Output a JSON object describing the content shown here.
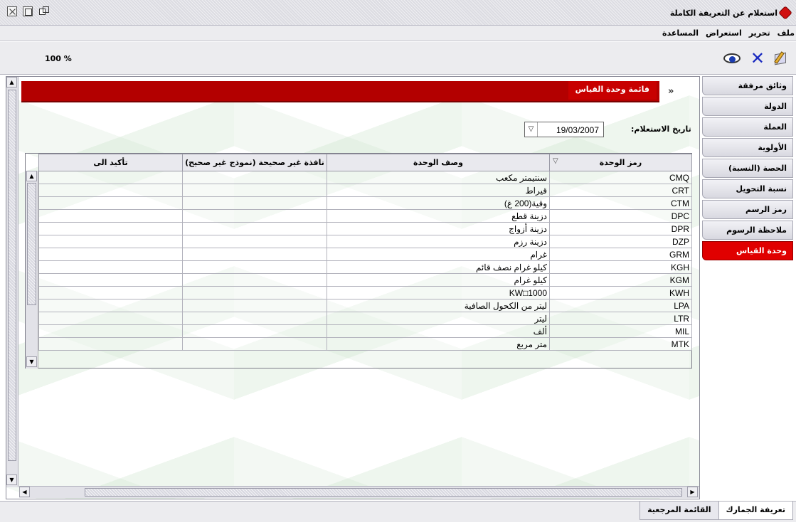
{
  "window": {
    "title": "استعلام عن التعريفة الكاملة"
  },
  "menu": [
    "ملف",
    "تحرير",
    "استعراض",
    "المساعدة"
  ],
  "toolbar": {
    "zoom": "100 %"
  },
  "panel": {
    "title": "قائمة وحدة القياس",
    "date_label": "تاريخ الاستعلام:",
    "date_value": "19/03/2007"
  },
  "table": {
    "columns": [
      "رمز الوحدة",
      "وصف الوحدة",
      "نافذة غير صحيحة (نموذج غير صحيح)",
      "تأكيد الى"
    ],
    "rows": [
      [
        "CMQ",
        "سنتيمتر مكعب"
      ],
      [
        "CRT",
        "قيراط"
      ],
      [
        "CTM",
        "وقية(200 غ)"
      ],
      [
        "DPC",
        "دزينة قطع"
      ],
      [
        "DPR",
        "دزينة أزواج"
      ],
      [
        "DZP",
        "دزينة رزم"
      ],
      [
        "GRM",
        "غرام"
      ],
      [
        "KGH",
        "كيلو غرام نصف قائم"
      ],
      [
        "KGM",
        "كيلو غرام"
      ],
      [
        "KWH",
        "1000□KW"
      ],
      [
        "LPA",
        "ليتر من الكحول الصافية"
      ],
      [
        "LTR",
        "ليتر"
      ],
      [
        "MIL",
        "ألف"
      ],
      [
        "MTK",
        "متر مربع"
      ]
    ]
  },
  "side_tabs": [
    "وثائق مرفقة",
    "الدولة",
    "العملة",
    "الأولوية",
    "الحصة (النسبة)",
    "نسبة التحويل",
    "رمز الرسم",
    "ملاحظة الرسوم",
    "وحدة القياس"
  ],
  "active_side_tab": "وحدة القياس",
  "bottom_tabs": [
    "تعريفة الجمارك",
    "القائمة المرجعية"
  ],
  "colors": {
    "accent": "#b30000",
    "active_tab": "#e00000"
  }
}
